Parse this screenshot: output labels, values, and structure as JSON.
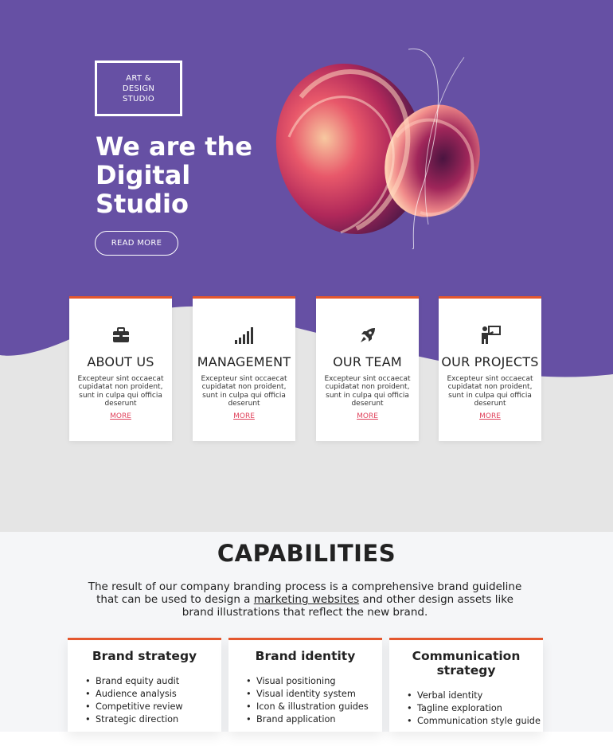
{
  "hero": {
    "brand_lines": [
      "ART &",
      "DESIGN",
      "STUDIO"
    ],
    "title": "We are the Digital Studio",
    "button_label": "READ MORE",
    "colors": {
      "hero_bg": "#6650a4",
      "page_bg": "#e5e5e5",
      "accent": "#e4572e",
      "link": "#e0405a"
    },
    "art": "abstract-3d-swirl-shape"
  },
  "features": [
    {
      "icon": "briefcase-icon",
      "title": "ABOUT US",
      "description": "Excepteur sint occaecat cupidatat non proident, sunt in culpa qui officia deserunt",
      "link": "MORE"
    },
    {
      "icon": "signal-bars-icon",
      "title": "MANAGEMENT",
      "description": "Excepteur sint occaecat cupidatat non proident, sunt in culpa qui officia deserunt",
      "link": "MORE"
    },
    {
      "icon": "rocket-icon",
      "title": "OUR TEAM",
      "description": "Excepteur sint occaecat cupidatat non proident, sunt in culpa qui officia deserunt",
      "link": "MORE"
    },
    {
      "icon": "presenter-icon",
      "title": "OUR PROJECTS",
      "description": "Excepteur sint occaecat cupidatat non proident, sunt in culpa qui officia deserunt",
      "link": "MORE"
    }
  ],
  "capabilities": {
    "title": "CAPABILITIES",
    "intro_before": "The result of our company branding process is a comprehensive brand guideline that can be used to design a ",
    "intro_link": "marketing websites",
    "intro_after": " and other design assets like brand illustrations that reflect the new brand.",
    "cards": [
      {
        "title": "Brand strategy",
        "items": [
          "Brand equity audit",
          "Audience analysis",
          "Competitive review",
          "Strategic direction"
        ]
      },
      {
        "title": "Brand identity",
        "items": [
          "Visual positioning",
          "Visual identity system",
          "Icon & illustration guides",
          "Brand application"
        ]
      },
      {
        "title": "Communication strategy",
        "items": [
          "Verbal identity",
          "Tagline exploration",
          "Communication style guide"
        ]
      }
    ]
  }
}
